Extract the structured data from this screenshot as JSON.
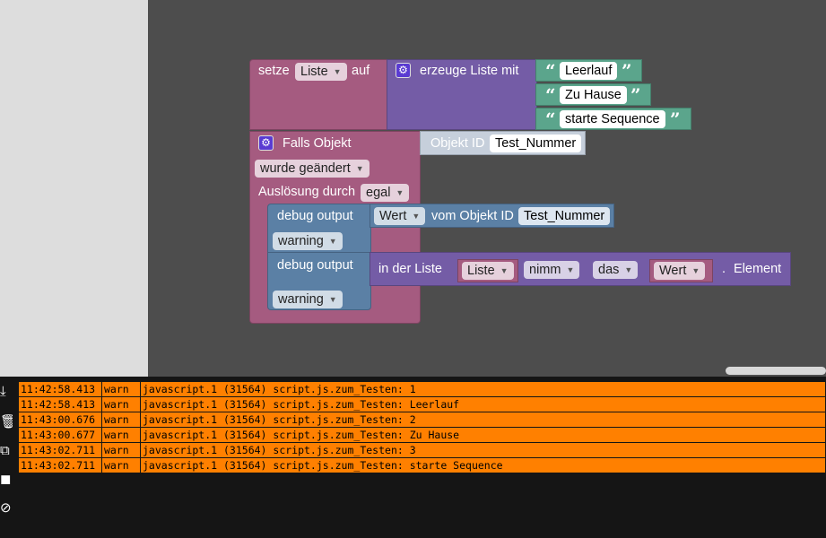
{
  "blocks": {
    "set_var": {
      "label": "setze",
      "variable": "Liste",
      "suffix": "auf"
    },
    "create_list": {
      "label": "erzeuge Liste mit",
      "items": [
        "Leerlauf",
        "Zu Hause",
        "starte Sequence"
      ]
    },
    "trigger": {
      "label": "Falls Objekt",
      "object_label": "Objekt ID",
      "object_id": "Test_Nummer",
      "condition": "wurde geändert",
      "trigger_label": "Auslösung durch",
      "trigger_value": "egal"
    },
    "debug1": {
      "label": "debug output",
      "value_field": "Wert",
      "of_object_label": "vom Objekt ID",
      "object_id": "Test_Nummer",
      "level": "warning"
    },
    "debug2": {
      "label": "debug output",
      "in_list_label": "in der Liste",
      "list_var": "Liste",
      "take": "nimm",
      "the": "das",
      "value_var": "Wert",
      "dot": ".",
      "element_label": "Element",
      "level": "warning"
    }
  },
  "log": {
    "rows": [
      {
        "time": "11:42:58.413",
        "severity": "warn",
        "message": "javascript.1 (31564) script.js.zum_Testen: 1"
      },
      {
        "time": "11:42:58.413",
        "severity": "warn",
        "message": "javascript.1 (31564) script.js.zum_Testen: Leerlauf"
      },
      {
        "time": "11:43:00.676",
        "severity": "warn",
        "message": "javascript.1 (31564) script.js.zum_Testen: 2"
      },
      {
        "time": "11:43:00.677",
        "severity": "warn",
        "message": "javascript.1 (31564) script.js.zum_Testen: Zu Hause"
      },
      {
        "time": "11:43:02.711",
        "severity": "warn",
        "message": "javascript.1 (31564) script.js.zum_Testen: 3"
      },
      {
        "time": "11:43:02.711",
        "severity": "warn",
        "message": "javascript.1 (31564) script.js.zum_Testen: starte Sequence"
      }
    ],
    "side_icons": [
      "download-icon",
      "delete-icon",
      "copy-icon",
      "pause-icon",
      "hide-icon"
    ]
  },
  "colors": {
    "variable_block": "#a55b80",
    "list_block": "#745ca6",
    "text_block": "#5ba58c",
    "debug_block": "#5b80a5",
    "object_block": "#c6cfdb",
    "log_warn_row": "#ff8000"
  }
}
